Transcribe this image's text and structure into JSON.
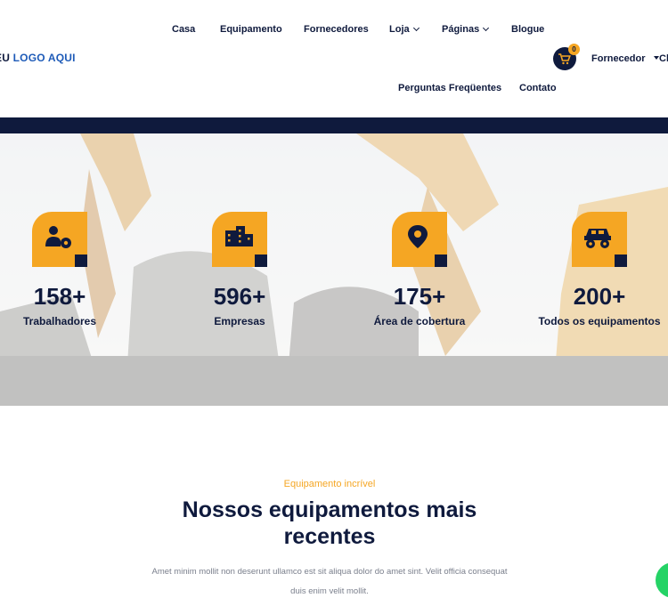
{
  "header": {
    "logo_part1": "EU",
    "logo_part2": "LOGO AQUI",
    "nav": {
      "home": "Casa",
      "equipment": "Equipamento",
      "suppliers": "Fornecedores",
      "shop": "Loja",
      "pages": "Páginas",
      "blog": "Blogue",
      "faq": "Perguntas Freqüentes",
      "contact": "Contato"
    },
    "cart_count": "0",
    "supplier_menu": "Fornecedor",
    "client_menu_partial": "Cl"
  },
  "stats": [
    {
      "number": "158+",
      "label": "Trabalhadores",
      "icon": "worker-gear-icon"
    },
    {
      "number": "596+",
      "label": "Empresas",
      "icon": "buildings-icon"
    },
    {
      "number": "175+",
      "label": "Área de cobertura",
      "icon": "location-pin-icon"
    },
    {
      "number": "200+",
      "label": "Todos os equipamentos",
      "icon": "monster-truck-icon"
    }
  ],
  "section": {
    "eyebrow": "Equipamento incrível",
    "title": "Nossos equipamentos mais recentes",
    "description": "Amet minim mollit non deserunt ullamco est sit aliqua dolor do amet sint. Velit officia consequat duis enim velit mollit."
  },
  "colors": {
    "navy": "#0f1a3d",
    "accent": "#f5a623",
    "logo_blue": "#1e5bb8",
    "chat_green": "#25d366"
  }
}
